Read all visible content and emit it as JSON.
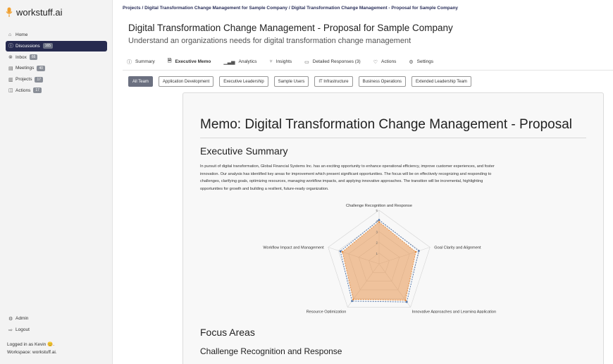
{
  "brand": {
    "name": "workstuff.ai",
    "logo_icon": "microphone-logo-icon",
    "accent": "#f0a030"
  },
  "sidebar": {
    "items": [
      {
        "label": "Home",
        "icon": "home-icon",
        "badge": null,
        "active": false
      },
      {
        "label": "Discussions",
        "icon": "discussion-icon",
        "badge": "165",
        "active": true
      },
      {
        "label": "Inbox",
        "icon": "inbox-icon",
        "badge": "66",
        "active": false
      },
      {
        "label": "Meetings",
        "icon": "meetings-icon",
        "badge": "40",
        "active": false
      },
      {
        "label": "Projects",
        "icon": "projects-icon",
        "badge": "17",
        "active": false
      },
      {
        "label": "Actions",
        "icon": "actions-icon",
        "badge": "17",
        "active": false
      }
    ],
    "bottom": [
      {
        "label": "Admin",
        "icon": "admin-gear-icon"
      },
      {
        "label": "Logout",
        "icon": "logout-icon"
      }
    ],
    "logged_in": "Logged in as Kevin 😊.",
    "workspace": "Workspace: workstuff.ai."
  },
  "header": {
    "breadcrumb": "Projects / Digital Transformation Change Management for Sample Company / Digital Transformation Change Management - Proposal for Sample Company",
    "title": "Digital Transformation Change Management - Proposal for Sample Company",
    "subtitle": "Understand an organizations needs for digital transformation change management"
  },
  "tabs": [
    {
      "label": "Summary",
      "icon": "info-icon",
      "active": false
    },
    {
      "label": "Executive Memo",
      "icon": "document-icon",
      "active": true
    },
    {
      "label": "Analytics",
      "icon": "bar-chart-icon",
      "active": false
    },
    {
      "label": "Insights",
      "icon": "network-icon",
      "active": false
    },
    {
      "label": "Detailed Responses (3)",
      "icon": "responses-icon",
      "active": false
    },
    {
      "label": "Actions",
      "icon": "lightbulb-icon",
      "active": false
    },
    {
      "label": "Settings",
      "icon": "settings-icon",
      "active": false
    }
  ],
  "filters": [
    {
      "label": "All Team",
      "active": true
    },
    {
      "label": "Application Development",
      "active": false
    },
    {
      "label": "Executive Leadership",
      "active": false
    },
    {
      "label": "Sample Users",
      "active": false
    },
    {
      "label": "IT Infrastructure",
      "active": false
    },
    {
      "label": "Business Operations",
      "active": false
    },
    {
      "label": "Extended Leadership Team",
      "active": false
    }
  ],
  "memo": {
    "title": "Memo: Digital Transformation Change Management - Proposal",
    "executive_summary_heading": "Executive Summary",
    "executive_summary_lines": [
      "In pursuit of digital transformation, Global Financial Systems Inc. has an exciting opportunity to enhance operational efficiency, improve customer experiences, and foster",
      "innovation. Our analysis has identified key areas for improvement which present significant opportunities. The focus will be on effectively recognizing and responding to",
      "challenges, clarifying goals, optimizing resources, managing workflow impacts, and applying innovative approaches. The transition will be incremental, highlighting",
      "opportunities for growth and building a resilient, future-ready organization."
    ],
    "focus_areas_heading": "Focus Areas",
    "sub_heading": "Challenge Recognition and Response"
  },
  "chart_data": {
    "type": "radar",
    "categories": [
      "Challenge Recognition and Response",
      "Goal Clarity and Alignment",
      "Innovative Approaches and Learning Application",
      "Resource Optimization",
      "Workflow Impact and Management"
    ],
    "series": [
      {
        "values": [
          3.9,
          3.6,
          4.2,
          4.1,
          3.6
        ],
        "color": "#e58a3c",
        "fill": "rgba(232,150,80,0.55)",
        "dashed": true
      },
      {
        "values": [
          4.1,
          3.9,
          4.4,
          4.3,
          3.8
        ],
        "color": "#4a6fa5",
        "fill": "none",
        "dashed": true
      }
    ],
    "scale": {
      "min": 0,
      "max": 5,
      "ticks": [
        "1",
        "2",
        "3",
        "4",
        "5"
      ]
    },
    "grid": true
  }
}
